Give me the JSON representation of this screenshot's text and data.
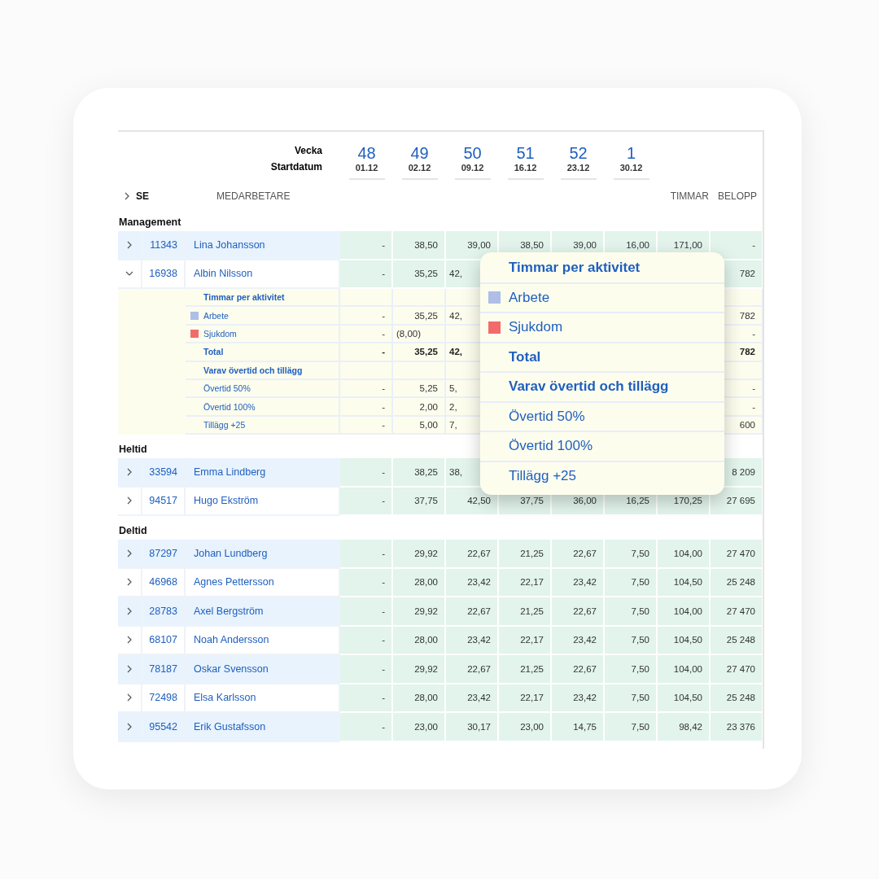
{
  "header": {
    "week_label": "Vecka",
    "date_label": "Startdatum",
    "weeks": [
      {
        "number": "48",
        "date": "01.12"
      },
      {
        "number": "49",
        "date": "02.12"
      },
      {
        "number": "50",
        "date": "09.12"
      },
      {
        "number": "51",
        "date": "16.12"
      },
      {
        "number": "52",
        "date": "23.12"
      },
      {
        "number": "1",
        "date": "30.12"
      }
    ]
  },
  "columns": {
    "group": "SE",
    "employee": "MEDARBETARE",
    "hours": "TIMMAR",
    "amount": "BELOPP"
  },
  "sections": [
    {
      "title": "Management",
      "rows": [
        {
          "id": "11343",
          "name": "Lina Johansson",
          "expanded": false,
          "values": [
            "-",
            "38,50",
            "39,00",
            "38,50",
            "39,00",
            "16,00",
            "171,00"
          ],
          "amount": "-"
        },
        {
          "id": "16938",
          "name": "Albin Nilsson",
          "expanded": true,
          "values": [
            "-",
            "35,25",
            "42,"
          ],
          "amount": "782",
          "details": [
            {
              "kind": "heading",
              "label": "Timmar per aktivitet"
            },
            {
              "kind": "activity",
              "label": "Arbete",
              "color": "#aebee6",
              "values": [
                "-",
                "35,25",
                "42,"
              ],
              "amount": "782"
            },
            {
              "kind": "activity",
              "label": "Sjukdom",
              "color": "#f26b6b",
              "values": [
                "-",
                "(8,00)"
              ],
              "amount": "-"
            },
            {
              "kind": "total",
              "label": "Total",
              "values": [
                "-",
                "35,25",
                "42,"
              ],
              "amount": "782"
            },
            {
              "kind": "heading",
              "label": "Varav övertid och tillägg"
            },
            {
              "kind": "item",
              "label": "Övertid 50%",
              "values": [
                "-",
                "5,25",
                "5,"
              ],
              "amount": "-"
            },
            {
              "kind": "item",
              "label": "Övertid 100%",
              "values": [
                "-",
                "2,00",
                "2,"
              ],
              "amount": "-"
            },
            {
              "kind": "item",
              "label": "Tillägg +25",
              "values": [
                "-",
                "5,00",
                "7,"
              ],
              "amount": "600"
            }
          ]
        }
      ]
    },
    {
      "title": "Heltid",
      "rows": [
        {
          "id": "33594",
          "name": "Emma Lindberg",
          "expanded": false,
          "values": [
            "-",
            "38,25",
            "38,"
          ],
          "amount": "8 209"
        },
        {
          "id": "94517",
          "name": "Hugo Ekström",
          "expanded": false,
          "values": [
            "-",
            "37,75",
            "42,50",
            "37,75",
            "36,00",
            "16,25",
            "170,25"
          ],
          "amount": "27 695"
        }
      ]
    },
    {
      "title": "Deltid",
      "rows": [
        {
          "id": "87297",
          "name": "Johan Lundberg",
          "expanded": false,
          "values": [
            "-",
            "29,92",
            "22,67",
            "21,25",
            "22,67",
            "7,50",
            "104,00"
          ],
          "amount": "27 470"
        },
        {
          "id": "46968",
          "name": "Agnes Pettersson",
          "expanded": false,
          "values": [
            "-",
            "28,00",
            "23,42",
            "22,17",
            "23,42",
            "7,50",
            "104,50"
          ],
          "amount": "25 248"
        },
        {
          "id": "28783",
          "name": "Axel Bergström",
          "expanded": false,
          "values": [
            "-",
            "29,92",
            "22,67",
            "21,25",
            "22,67",
            "7,50",
            "104,00"
          ],
          "amount": "27 470"
        },
        {
          "id": "68107",
          "name": "Noah Andersson",
          "expanded": false,
          "values": [
            "-",
            "28,00",
            "23,42",
            "22,17",
            "23,42",
            "7,50",
            "104,50"
          ],
          "amount": "25 248"
        },
        {
          "id": "78187",
          "name": "Oskar Svensson",
          "expanded": false,
          "values": [
            "-",
            "29,92",
            "22,67",
            "21,25",
            "22,67",
            "7,50",
            "104,00"
          ],
          "amount": "27 470"
        },
        {
          "id": "72498",
          "name": "Elsa Karlsson",
          "expanded": false,
          "values": [
            "-",
            "28,00",
            "23,42",
            "22,17",
            "23,42",
            "7,50",
            "104,50"
          ],
          "amount": "25 248"
        },
        {
          "id": "95542",
          "name": "Erik Gustafsson",
          "expanded": false,
          "values": [
            "-",
            "23,00",
            "30,17",
            "23,00",
            "14,75",
            "7,50",
            "98,42"
          ],
          "amount": "23 376"
        }
      ]
    }
  ],
  "popover": {
    "items": [
      {
        "kind": "heading",
        "label": "Timmar per aktivitet"
      },
      {
        "kind": "activity",
        "label": "Arbete",
        "color": "#aebee6"
      },
      {
        "kind": "activity",
        "label": "Sjukdom",
        "color": "#f26b6b"
      },
      {
        "kind": "total",
        "label": "Total"
      },
      {
        "kind": "heading",
        "label": "Varav övertid och tillägg"
      },
      {
        "kind": "item",
        "label": "Övertid 50%"
      },
      {
        "kind": "item",
        "label": "Övertid 100%"
      },
      {
        "kind": "item",
        "label": "Tillägg +25"
      }
    ]
  }
}
